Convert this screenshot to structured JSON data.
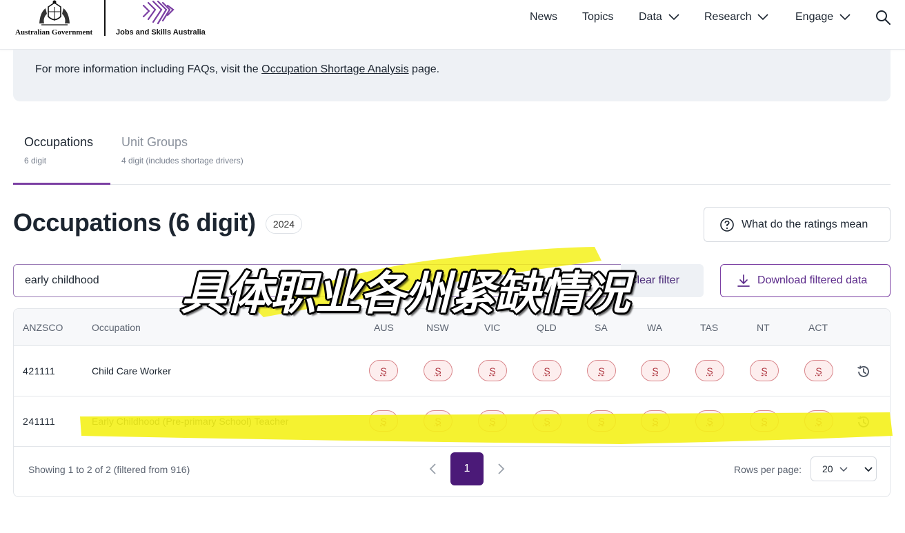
{
  "header": {
    "gov_text": "Australian Government",
    "jsa_text": "Jobs and Skills Australia",
    "nav": {
      "news": "News",
      "topics": "Topics",
      "data": "Data",
      "research": "Research",
      "engage": "Engage"
    }
  },
  "info": {
    "prefix": "For more information including FAQs, visit the ",
    "link": "Occupation Shortage Analysis",
    "suffix": " page."
  },
  "tabs": [
    {
      "title": "Occupations",
      "sub": "6 digit"
    },
    {
      "title": "Unit Groups",
      "sub": "4 digit (includes shortage drivers)"
    }
  ],
  "title": "Occupations (6 digit)",
  "year": "2024",
  "ratings_button": "What do the ratings mean",
  "search": {
    "value": "early childhood"
  },
  "filter_label": "Clear filter",
  "download_button": "Download filtered data",
  "table": {
    "headers": {
      "anzsco": "ANZSCO",
      "occupation": "Occupation",
      "states": [
        "AUS",
        "NSW",
        "VIC",
        "QLD",
        "SA",
        "WA",
        "TAS",
        "NT",
        "ACT"
      ]
    },
    "rows": [
      {
        "code": "421111",
        "occupation": "Child Care Worker",
        "ratings": [
          "S",
          "S",
          "S",
          "S",
          "S",
          "S",
          "S",
          "S",
          "S"
        ]
      },
      {
        "code": "241111",
        "occupation": "Early Childhood (Pre-primary School) Teacher",
        "ratings": [
          "S",
          "S",
          "S",
          "S",
          "S",
          "S",
          "S",
          "S",
          "S"
        ]
      }
    ]
  },
  "pagination": {
    "showing": "Showing 1 to 2 of 2 (filtered from 916)",
    "current_page": "1",
    "rows_label": "Rows per page:",
    "rows_value": "20"
  },
  "overlay_caption": "具体职业各州紧缺情况",
  "colors": {
    "accent": "#4b1a78",
    "shortage": "#b03a44",
    "highlighter": "#f4f11a"
  }
}
